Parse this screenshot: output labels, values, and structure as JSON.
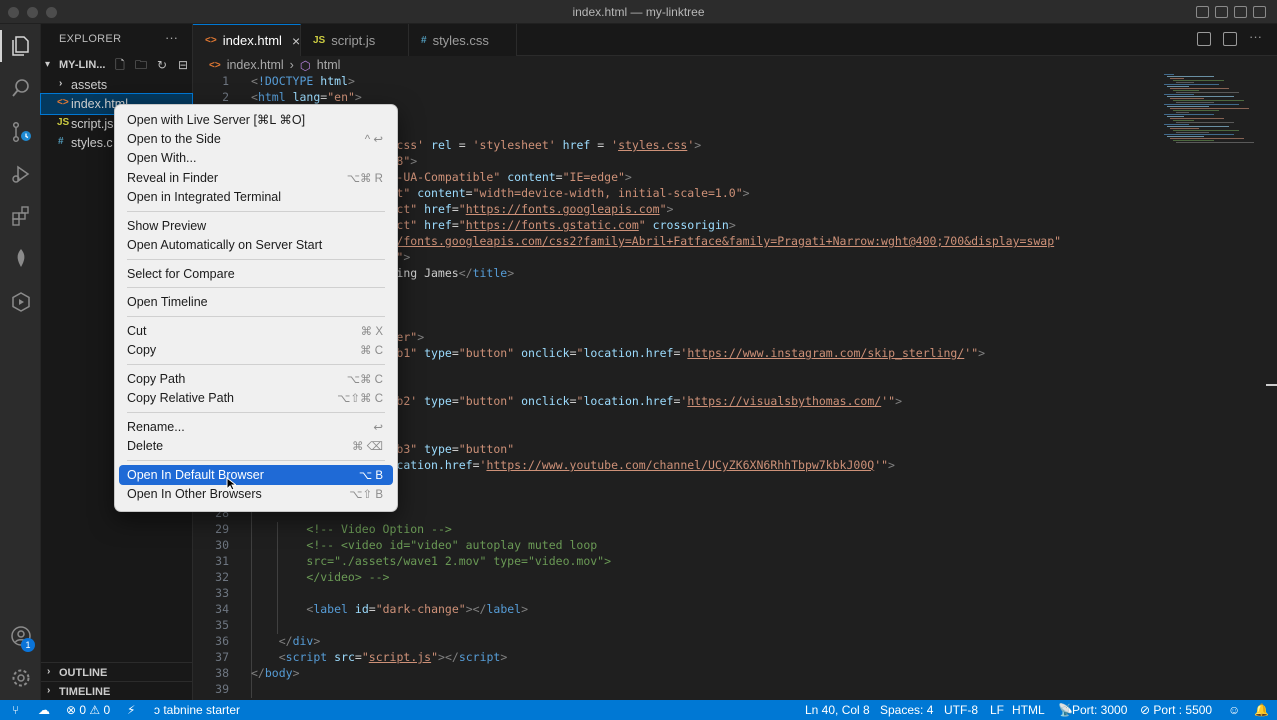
{
  "window": {
    "title": "index.html — my-linktree"
  },
  "activity_bar": {
    "items": [
      "explorer-icon",
      "search-icon",
      "source-control-icon",
      "run-debug-icon",
      "extensions-icon",
      "tabnine-icon",
      "remote-icon"
    ],
    "accounts_badge": "1"
  },
  "sidebar": {
    "header": "EXPLORER",
    "more": "···",
    "folder": "MY-LIN...",
    "items": [
      {
        "label": "assets",
        "icon": "›"
      },
      {
        "label": "index.html",
        "icon": "<>"
      },
      {
        "label": "script.js",
        "icon": "JS"
      },
      {
        "label": "styles.c",
        "icon": "#"
      }
    ],
    "outline": "OUTLINE",
    "timeline": "TIMELINE"
  },
  "tabs": [
    {
      "label": "index.html",
      "icon": "<>",
      "close": "×"
    },
    {
      "label": "script.js",
      "icon": "JS"
    },
    {
      "label": "styles.css",
      "icon": "#"
    }
  ],
  "breadcrumb": {
    "file": "index.html",
    "sep": "›",
    "symbol": "html"
  },
  "editor": {
    "lines": [
      {
        "n": "1",
        "html": "<span class='t-punct'>&lt;</span><span class='t-doc'>!DOCTYPE</span> <span class='t-attr'>html</span><span class='t-punct'>&gt;</span>"
      },
      {
        "n": "2",
        "html": "<span class='t-punct'>&lt;</span><span class='t-tag'>html</span> <span class='t-attr'>lang</span>=<span class='t-str'>\"en\"</span><span class='t-punct'>&gt;</span>"
      },
      {
        "n": "",
        "html": ""
      },
      {
        "n": "",
        "html": ""
      },
      {
        "n": "",
        "html": "                     <span class='t-str'>css'</span> <span class='t-attr'>rel</span> = <span class='t-str'>'stylesheet'</span> <span class='t-attr'>href</span> = <span class='t-str'>'<u>styles.css</u>'</span><span class='t-punct'>&gt;</span>"
      },
      {
        "n": "",
        "html": "                     <span class='t-str'>8\"</span><span class='t-punct'>&gt;</span>"
      },
      {
        "n": "",
        "html": "                     <span class='t-str'>-UA-Compatible\"</span> <span class='t-attr'>content</span>=<span class='t-str'>\"IE=edge\"</span><span class='t-punct'>&gt;</span>"
      },
      {
        "n": "",
        "html": "                     <span class='t-str'>t\"</span> <span class='t-attr'>content</span>=<span class='t-str'>\"width=device-width, initial-scale=1.0\"</span><span class='t-punct'>&gt;</span>"
      },
      {
        "n": "",
        "html": "                     <span class='t-str'>ct\"</span> <span class='t-attr'>href</span>=<span class='t-str'>\"<u>https://fonts.googleapis.com</u>\"</span><span class='t-punct'>&gt;</span>"
      },
      {
        "n": "",
        "html": "                     <span class='t-str'>ct\"</span> <span class='t-attr'>href</span>=<span class='t-str'>\"<u>https://fonts.gstatic.com</u>\"</span> <span class='t-attr'>crossorigin</span><span class='t-punct'>&gt;</span>"
      },
      {
        "n": "",
        "html": "                     <span class='t-str'><u>/fonts.googleapis.com/css2?family=Abril+Fatface&amp;family=Pragati+Narrow:wght@400;700&amp;display=swap</u>\"</span>"
      },
      {
        "n": "",
        "html": "                     <span class='t-str'>\"</span><span class='t-punct'>&gt;</span>"
      },
      {
        "n": "",
        "html": "                     ing James<span class='t-punct'>&lt;/</span><span class='t-tag'>title</span><span class='t-punct'>&gt;</span>"
      },
      {
        "n": "",
        "html": ""
      },
      {
        "n": "",
        "html": ""
      },
      {
        "n": "",
        "html": ""
      },
      {
        "n": "",
        "html": "                     <span class='t-str'>er\"</span><span class='t-punct'>&gt;</span>"
      },
      {
        "n": "",
        "html": "                     <span class='t-str'>b1\"</span> <span class='t-attr'>type</span>=<span class='t-str'>\"button\"</span> <span class='t-attr'>onclick</span>=<span class='t-str'>\"</span><span class='t-attr'>location.href</span>=<span class='t-str'>'<u>https://www.instagram.com/skip_sterling/</u>'\"</span><span class='t-punct'>&gt;</span>"
      },
      {
        "n": "",
        "html": ""
      },
      {
        "n": "",
        "html": ""
      },
      {
        "n": "",
        "html": "                     <span class='t-str'>b2'</span> <span class='t-attr'>type</span>=<span class='t-str'>\"button\"</span> <span class='t-attr'>onclick</span>=<span class='t-str'>\"</span><span class='t-attr'>location.href</span>=<span class='t-str'>'<u>https://visualsbythomas.com/</u>'\"</span><span class='t-punct'>&gt;</span>"
      },
      {
        "n": "",
        "html": ""
      },
      {
        "n": "",
        "html": ""
      },
      {
        "n": "",
        "html": "                     <span class='t-str'>b3\"</span> <span class='t-attr'>type</span>=<span class='t-str'>\"button\"</span>"
      },
      {
        "n": "",
        "html": "                     <span class='t-attr'>cation.href</span>=<span class='t-str'>'<u>https://www.youtube.com/channel/UCyZK6XN6RhhTbpw7kbkJ00Q</u>'\"</span><span class='t-punct'>&gt;</span>"
      },
      {
        "n": "",
        "html": ""
      },
      {
        "n": "",
        "html": ""
      },
      {
        "n": "28",
        "html": ""
      },
      {
        "n": "29",
        "html": "        <span class='t-com'>&lt;!-- Video Option --&gt;</span>"
      },
      {
        "n": "30",
        "html": "        <span class='t-com'>&lt;!-- &lt;video id=\"video\" autoplay muted loop</span>"
      },
      {
        "n": "31",
        "html": "        <span class='t-com'>src=\"./assets/wave1 2.mov\" type=\"video.mov\"&gt;</span>"
      },
      {
        "n": "32",
        "html": "        <span class='t-com'>&lt;/video&gt; --&gt;</span>"
      },
      {
        "n": "33",
        "html": ""
      },
      {
        "n": "34",
        "html": "        <span class='t-punct'>&lt;</span><span class='t-tag'>label</span> <span class='t-attr'>id</span>=<span class='t-str'>\"dark-change\"</span><span class='t-punct'>&gt;&lt;/</span><span class='t-tag'>label</span><span class='t-punct'>&gt;</span>"
      },
      {
        "n": "35",
        "html": ""
      },
      {
        "n": "36",
        "html": "    <span class='t-punct'>&lt;/</span><span class='t-tag'>div</span><span class='t-punct'>&gt;</span>"
      },
      {
        "n": "37",
        "html": "    <span class='t-punct'>&lt;</span><span class='t-tag'>script</span> <span class='t-attr'>src</span>=<span class='t-str'>\"<u>script.js</u>\"</span><span class='t-punct'>&gt;&lt;/</span><span class='t-tag'>script</span><span class='t-punct'>&gt;</span>"
      },
      {
        "n": "38",
        "html": "<span class='t-punct'>&lt;/</span><span class='t-tag'>body</span><span class='t-punct'>&gt;</span>"
      },
      {
        "n": "39",
        "html": ""
      }
    ]
  },
  "context_menu": {
    "groups": [
      [
        {
          "label": "Open with Live Server [⌘L ⌘O]",
          "shortcut": ""
        },
        {
          "label": "Open to the Side",
          "shortcut": "^ ↩"
        },
        {
          "label": "Open With...",
          "shortcut": ""
        },
        {
          "label": "Reveal in Finder",
          "shortcut": "⌥⌘ R"
        },
        {
          "label": "Open in Integrated Terminal",
          "shortcut": ""
        }
      ],
      [
        {
          "label": "Show Preview",
          "shortcut": ""
        },
        {
          "label": "Open Automatically on Server Start",
          "shortcut": ""
        }
      ],
      [
        {
          "label": "Select for Compare",
          "shortcut": ""
        }
      ],
      [
        {
          "label": "Open Timeline",
          "shortcut": ""
        }
      ],
      [
        {
          "label": "Cut",
          "shortcut": "⌘ X"
        },
        {
          "label": "Copy",
          "shortcut": "⌘ C"
        }
      ],
      [
        {
          "label": "Copy Path",
          "shortcut": "⌥⌘ C"
        },
        {
          "label": "Copy Relative Path",
          "shortcut": "⌥⇧⌘ C"
        }
      ],
      [
        {
          "label": "Rename...",
          "shortcut": "↩"
        },
        {
          "label": "Delete",
          "shortcut": "⌘ ⌫"
        }
      ],
      [
        {
          "label": "Open In Default Browser",
          "shortcut": "⌥ B",
          "highlighted": true
        },
        {
          "label": "Open In Other Browsers",
          "shortcut": "⌥⇧ B"
        }
      ]
    ]
  },
  "status_bar": {
    "problems": "⊗ 0 ⚠ 0",
    "tabnine": "ↄ tabnine starter",
    "position": "Ln 40, Col 8",
    "spaces": "Spaces: 4",
    "encoding": "UTF-8",
    "eol": "LF",
    "language": "HTML",
    "port": "Port: 3000",
    "live_port": "⊘ Port : 5500"
  },
  "colors": {
    "accent": "#0078d4",
    "menu_highlight": "#1f6ad6",
    "html_icon": "#e37933",
    "js_icon": "#cbcb41",
    "css_icon": "#519aba"
  }
}
